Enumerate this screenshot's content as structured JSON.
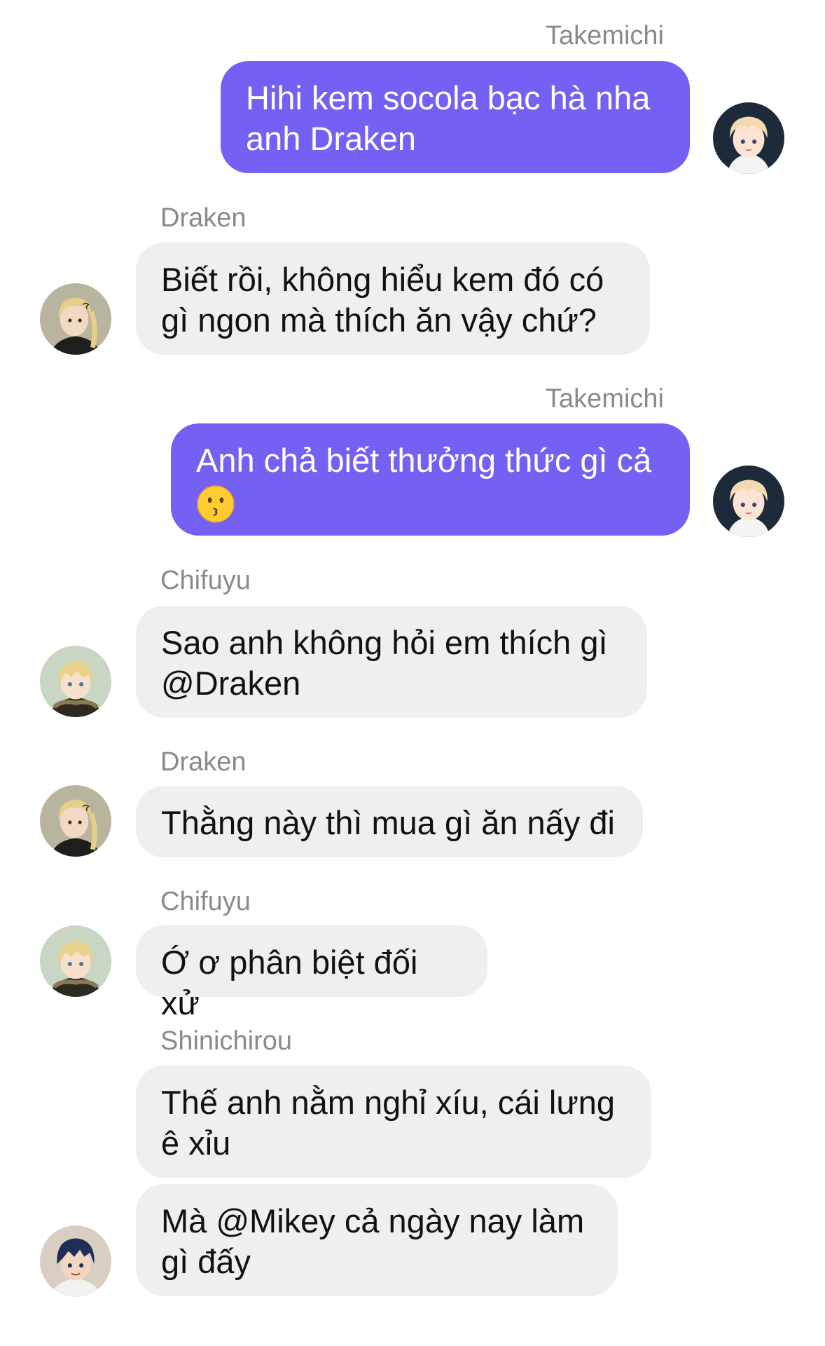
{
  "messages": [
    {
      "sender": "Takemichi",
      "text": "Hihi kem socola bạc hà nha anh Draken",
      "avatar": "takemichi-avatar"
    },
    {
      "sender": "Draken",
      "text": "Biết rồi, không hiểu kem đó có gì ngon mà thích ăn vậy chứ?",
      "avatar": "draken-avatar"
    },
    {
      "sender": "Takemichi",
      "text": "Anh chả biết thưởng thức gì cả",
      "emoji": "kissing-face-emoji",
      "avatar": "takemichi-avatar"
    },
    {
      "sender": "Chifuyu",
      "text": "Sao anh không hỏi em thích gì @Draken",
      "avatar": "chifuyu-avatar"
    },
    {
      "sender": "Draken",
      "text": "Thằng này thì mua gì ăn nấy đi",
      "avatar": "draken-avatar"
    },
    {
      "sender": "Chifuyu",
      "text": "Ớ ơ phân biệt đối xử",
      "avatar": "chifuyu-avatar"
    },
    {
      "sender": "Shinichirou",
      "text": "Thế anh nằm nghỉ xíu, cái lưng ê xỉu"
    },
    {
      "text": "Mà @Mikey cả ngày nay làm gì đấy",
      "avatar": "shinichirou-avatar"
    }
  ],
  "colors": {
    "outgoing_bubble": "#7560f4",
    "incoming_bubble": "#efeff0",
    "sender_label": "#8a8a8e"
  }
}
